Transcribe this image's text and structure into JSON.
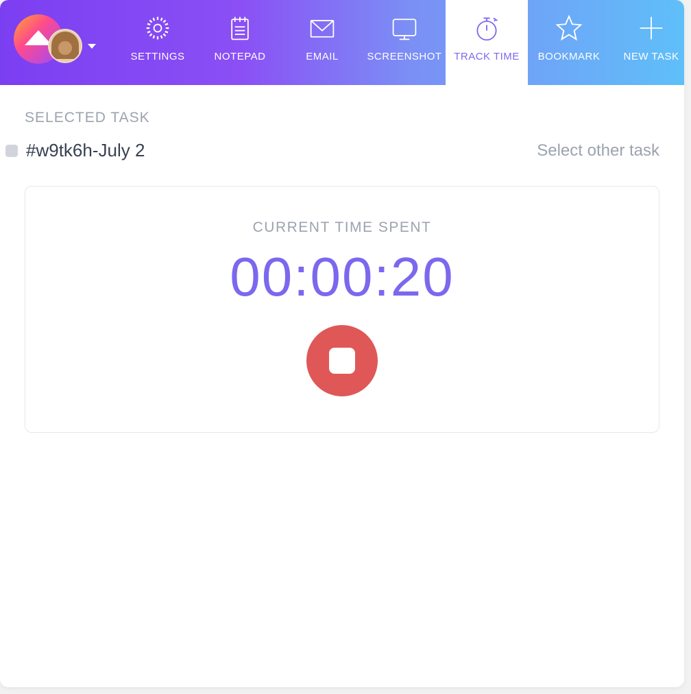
{
  "tabs": [
    {
      "label": "SETTINGS",
      "icon": "gear-icon"
    },
    {
      "label": "NOTEPAD",
      "icon": "notepad-icon"
    },
    {
      "label": "EMAIL",
      "icon": "mail-icon"
    },
    {
      "label": "SCREENSHOT",
      "icon": "monitor-icon"
    },
    {
      "label": "TRACK TIME",
      "icon": "stopwatch-icon",
      "active": true
    },
    {
      "label": "BOOKMARK",
      "icon": "star-icon"
    },
    {
      "label": "NEW TASK",
      "icon": "plus-icon"
    }
  ],
  "section_label": "SELECTED TASK",
  "task": {
    "name": "#w9tk6h-July 2",
    "select_other_label": "Select other task"
  },
  "timer": {
    "label": "CURRENT TIME SPENT",
    "value": "00:00:20"
  },
  "colors": {
    "accent": "#7B68EE",
    "stop": "#E05757"
  }
}
